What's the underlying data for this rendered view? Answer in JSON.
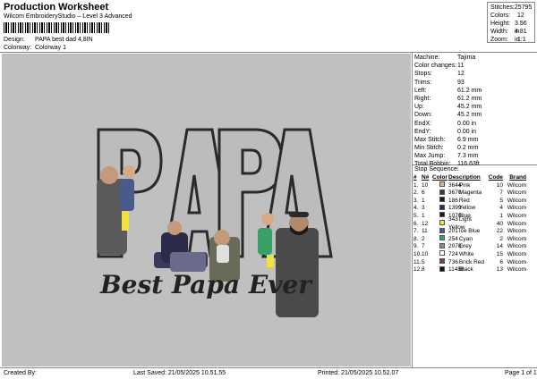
{
  "header": {
    "title": "Production Worksheet",
    "software": "Wilcom EmbroideryStudio – Level 3 Advanced",
    "design_label": "Design:",
    "design_value": "PAPA best dad 4,8IN",
    "colorway_label": "Colorway:",
    "colorway_value": "Colorway 1"
  },
  "stats": [
    {
      "k": "Stitches:",
      "v": "25795"
    },
    {
      "k": "Colors:",
      "v": "12"
    },
    {
      "k": "Height:",
      "v": "3.56 in"
    },
    {
      "k": "Width:",
      "v": "4.81 in"
    },
    {
      "k": "Zoom:",
      "v": "1:1"
    }
  ],
  "machine": [
    {
      "k": "Machine:",
      "v": "Tajima"
    },
    {
      "k": "Color changes:",
      "v": "11"
    },
    {
      "k": "Stops:",
      "v": "12"
    },
    {
      "k": "Trims:",
      "v": "93"
    },
    {
      "k": "Left:",
      "v": "61.2 mm"
    },
    {
      "k": "Right:",
      "v": "61.2 mm"
    },
    {
      "k": "Up:",
      "v": "45.2 mm"
    },
    {
      "k": "Down:",
      "v": "45.2 mm"
    },
    {
      "k": "EndX:",
      "v": "0.00 in"
    },
    {
      "k": "EndY:",
      "v": "0.00 in"
    },
    {
      "k": "Max Stitch:",
      "v": "6.9 mm"
    },
    {
      "k": "Min Stitch:",
      "v": "0.2 mm"
    },
    {
      "k": "Max Jump:",
      "v": "7.3 mm"
    },
    {
      "k": "Total Bobbin:",
      "v": "116.63ft"
    }
  ],
  "stop_sequence": {
    "title": "Stop Sequence:",
    "headers": [
      "#",
      "N#",
      "Color",
      "Description",
      "Code",
      "Brand"
    ],
    "rows": [
      {
        "n": "1.",
        "id": "10",
        "color": "#d9b49a",
        "num": "3644",
        "desc": "Pink",
        "code": "10",
        "brand": "Wilcom"
      },
      {
        "n": "2.",
        "id": "6",
        "color": "#3a3a3a",
        "num": "3670",
        "desc": "Magenta",
        "code": "7",
        "brand": "Wilcom"
      },
      {
        "n": "3.",
        "id": "1",
        "color": "#1a1a1a",
        "num": "186",
        "desc": "Red",
        "code": "5",
        "brand": "Wilcom"
      },
      {
        "n": "4.",
        "id": "3",
        "color": "#2c2c4a",
        "num": "1399",
        "desc": "Yellow",
        "code": "4",
        "brand": "Wilcom"
      },
      {
        "n": "5.",
        "id": "1",
        "color": "#1a1a1a",
        "num": "1070",
        "desc": "Blue",
        "code": "1",
        "brand": "Wilcom"
      },
      {
        "n": "6.",
        "id": "12",
        "color": "#f0e040",
        "num": "343",
        "desc": "Light Yellow",
        "code": "40",
        "brand": "Wilcom"
      },
      {
        "n": "7.",
        "id": "11",
        "color": "#4a5a8a",
        "num": "201",
        "desc": "Ice Blue",
        "code": "22",
        "brand": "Wilcom"
      },
      {
        "n": "8.",
        "id": "2",
        "color": "#3aa06a",
        "num": "254",
        "desc": "Cyan",
        "code": "2",
        "brand": "Wilcom"
      },
      {
        "n": "9.",
        "id": "7",
        "color": "#8a8a8a",
        "num": "2078",
        "desc": "Grey",
        "code": "14",
        "brand": "Wilcom"
      },
      {
        "n": "10.",
        "id": "10",
        "color": "#ffffff",
        "num": "724",
        "desc": "White",
        "code": "15",
        "brand": "Wilcom"
      },
      {
        "n": "11.",
        "id": "5",
        "color": "#6a4a3a",
        "num": "736",
        "desc": "Brick Red",
        "code": "6",
        "brand": "Wilcom"
      },
      {
        "n": "12.",
        "id": "8",
        "color": "#111111",
        "num": "11488",
        "desc": "Black",
        "code": "13",
        "brand": "Wilcom"
      }
    ]
  },
  "design": {
    "word": "PAPA",
    "tagline": "Best Papa Ever"
  },
  "footer": {
    "created_by": "Created By:",
    "last_saved": "Last Saved: 21/05/2025 10.51.55",
    "printed": "Printed: 21/05/2025 10.52.07",
    "page": "Page 1 of 1"
  }
}
